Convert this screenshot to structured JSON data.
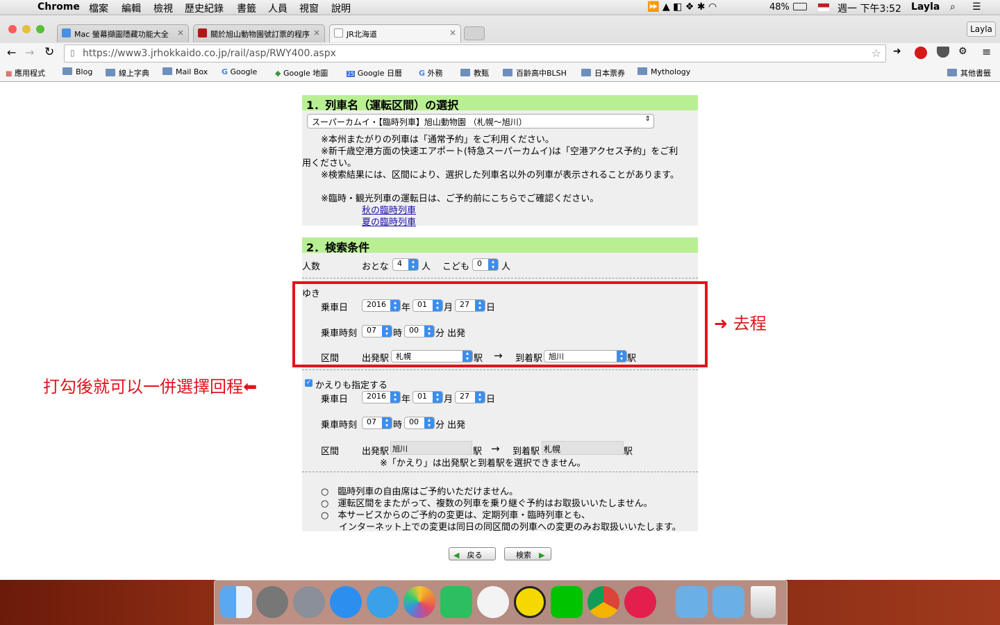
{
  "menubar": {
    "app": "Chrome",
    "items": [
      "檔案",
      "編輯",
      "檢視",
      "歷史紀錄",
      "書籤",
      "人員",
      "視窗",
      "說明"
    ],
    "battery": "48%",
    "clock": "週一 下午3:52",
    "user": "Layla"
  },
  "tabs": [
    {
      "title": "Mac 螢幕擷圖隱藏功能大全"
    },
    {
      "title": "關於旭山動物園號訂票的程序"
    },
    {
      "title": "JR北海道"
    }
  ],
  "profile_button": "Layla",
  "url": "https://www3.jrhokkaido.co.jp/rail/asp/RWY400.aspx",
  "bookmarks": [
    "應用程式",
    "Blog",
    "線上字典",
    "Mail Box",
    "Google",
    "Google 地圖",
    "Google 日曆",
    "外務",
    "教甄",
    "百齡高中BLSH",
    "日本票券",
    "Mythology"
  ],
  "other_bookmarks": "其他書籤",
  "section1": {
    "heading": "1．列車名（運転区間）の選択",
    "train_select": "スーパーカムイ・【臨時列車】旭山動物園 （札幌〜旭川）",
    "note1": "※本州またがりの列車は「通常予約」をご利用ください。",
    "note2a": "※新千歳空港方面の快速エアポート(特急スーパーカムイ)は「空港アクセス予約」をご利",
    "note2b": "用ください。",
    "note3": "※検索結果には、区間により、選択した列車名以外の列車が表示されることがあります。",
    "note4": "※臨時・観光列車の運転日は、ご予約前にこちらでご確認ください。",
    "link_autumn": "秋の臨時列車",
    "link_summer": "夏の臨時列車"
  },
  "section2": {
    "heading": "2．検索条件",
    "persons_label": "人数",
    "adult_label": "おとな",
    "adult_value": "4",
    "person_unit": "人",
    "child_label": "こども",
    "child_value": "0",
    "outbound": {
      "title": "ゆき",
      "date_label": "乗車日",
      "year": "2016",
      "year_unit": "年",
      "month": "01",
      "month_unit": "月",
      "day": "27",
      "day_unit": "日",
      "time_label": "乗車時刻",
      "hour": "07",
      "hour_unit": "時",
      "minute": "00",
      "minute_unit": "分 出発",
      "section_label": "区間",
      "dep_label": "出発駅",
      "dep_value": "札幌",
      "station_unit": "駅",
      "arrow": "→",
      "arr_label": "到着駅",
      "arr_value": "旭川"
    },
    "return": {
      "checkbox_label": "かえりも指定する",
      "date_label": "乗車日",
      "year": "2016",
      "year_unit": "年",
      "month": "01",
      "month_unit": "月",
      "day": "27",
      "day_unit": "日",
      "time_label": "乗車時刻",
      "hour": "07",
      "hour_unit": "時",
      "minute": "00",
      "minute_unit": "分 出発",
      "section_label": "区間",
      "dep_label": "出発駅",
      "dep_value": "旭川",
      "station_unit": "駅",
      "arrow": "→",
      "arr_label": "到着駅",
      "arr_value": "札幌",
      "note": "※「かえり」は出発駅と到着駅を選択できません。"
    },
    "notices": [
      "臨時列車の自由席はご予約いただけません。",
      "運転区間をまたがって、複数の列車を乗り継ぐ予約はお取扱いいたしません。",
      "本サービスからのご予約の変更は、定期列車・臨時列車とも、"
    ],
    "notice3b": "インターネット上での変更は同日の同区間の列車への変更のみお取扱いいたします。"
  },
  "buttons": {
    "back": "戻る",
    "search": "検索"
  },
  "annotations": {
    "outbound": "去程",
    "return": "打勾後就可以一併選擇回程"
  },
  "colors": {
    "header_green": "#b9ef93",
    "annotation_red": "#e0141c"
  }
}
